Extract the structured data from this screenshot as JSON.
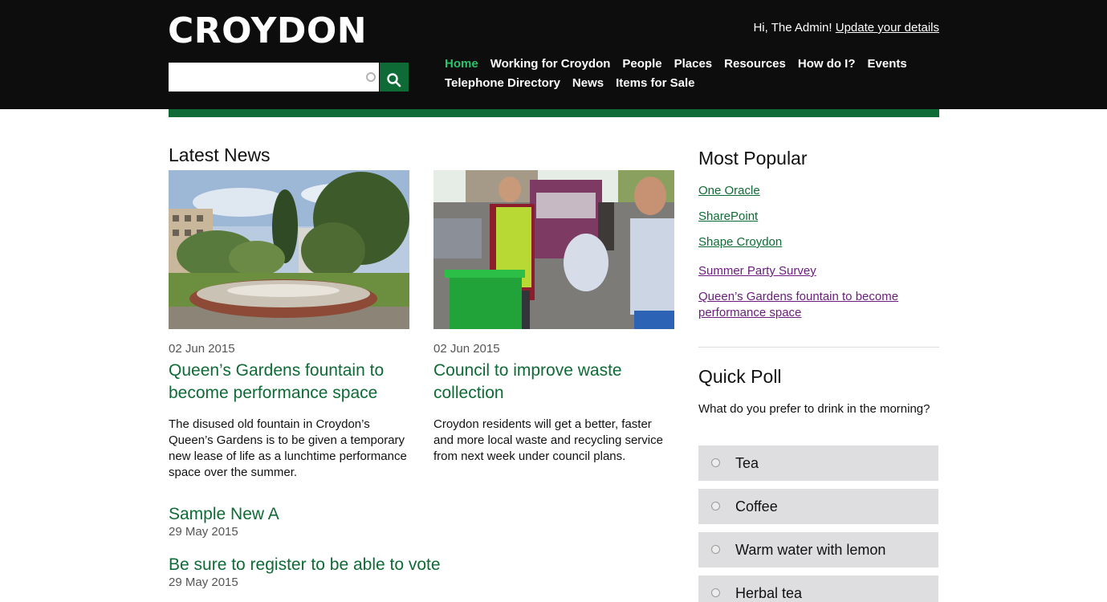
{
  "header": {
    "logo": "CROYDON",
    "greeting_prefix": "Hi, The Admin!",
    "update_link": "Update your details",
    "search": {
      "value": "",
      "placeholder": ""
    },
    "nav": [
      {
        "label": "Home",
        "active": true
      },
      {
        "label": "Working for Croydon"
      },
      {
        "label": "People"
      },
      {
        "label": "Places"
      },
      {
        "label": "Resources"
      },
      {
        "label": "How do I?"
      },
      {
        "label": "Events"
      },
      {
        "label": "Telephone Directory"
      },
      {
        "label": "News"
      },
      {
        "label": "Items for Sale"
      }
    ],
    "colors": {
      "bar": "#0d0d0d",
      "accent": "#0e6b35",
      "active_nav": "#27c46b"
    }
  },
  "latest_news": {
    "title": "Latest News",
    "featured": [
      {
        "date": "02 Jun 2015",
        "title": "Queen’s Gardens fountain to become performance space",
        "summary": "The disused old fountain in Croydon’s Queen’s Gardens is to be given a temporary new lease of life as a lunchtime performance space over the summer.",
        "image_icon": "garden-fountain-photo"
      },
      {
        "date": "02 Jun 2015",
        "title": "Council to improve waste collection",
        "summary": "Croydon residents will get a better, faster and more local waste and recycling service from next week under council plans.",
        "image_icon": "waste-collection-photo"
      }
    ],
    "more": [
      {
        "title": "Sample New A",
        "date": "29 May 2015"
      },
      {
        "title": "Be sure to register to be able to vote",
        "date": "29 May 2015"
      }
    ]
  },
  "most_popular": {
    "title": "Most Popular",
    "links": [
      {
        "label": "One Oracle",
        "visited": false
      },
      {
        "label": "SharePoint",
        "visited": false
      },
      {
        "label": "Shape Croydon",
        "visited": false
      },
      {
        "label": "Summer Party Survey",
        "visited": true
      },
      {
        "label": "Queen’s Gardens fountain to become performance space",
        "visited": true
      }
    ],
    "colors": {
      "link": "#0e6b35",
      "visited": "#6a1b7c"
    }
  },
  "quick_poll": {
    "title": "Quick Poll",
    "question": "What do you prefer to drink in the morning?",
    "options": [
      "Tea",
      "Coffee",
      "Warm water with lemon",
      "Herbal tea"
    ]
  }
}
